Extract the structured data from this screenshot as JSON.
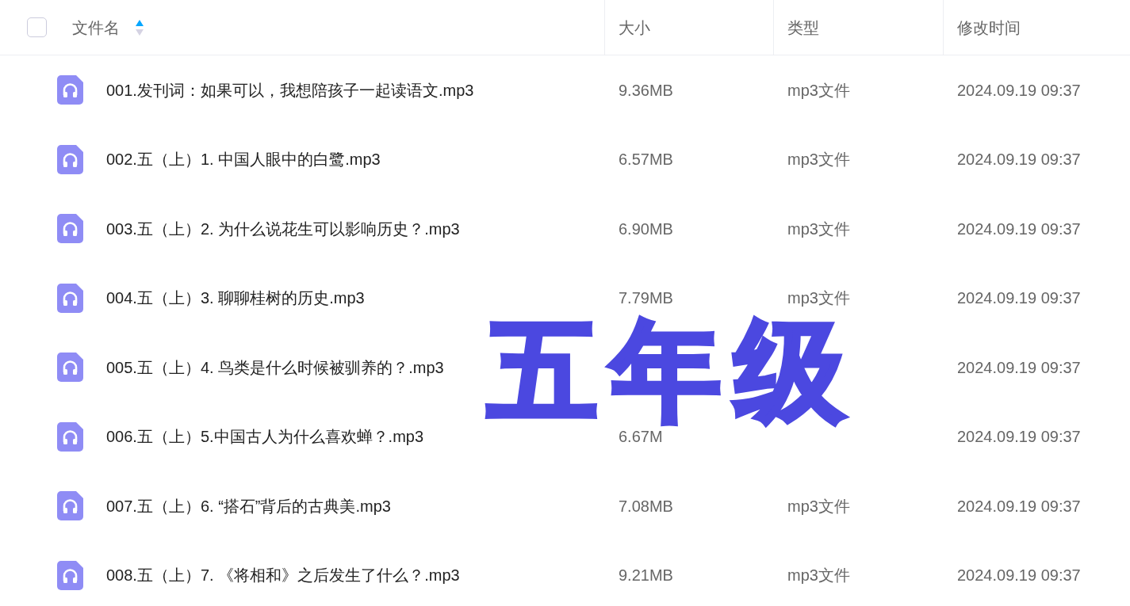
{
  "header": {
    "select_all": {
      "checked": false
    },
    "columns": [
      "文件名",
      "大小",
      "类型",
      "修改时间"
    ]
  },
  "rows": [
    {
      "name": "001.发刊词：如果可以，我想陪孩子一起读语文.mp3",
      "size": "9.36MB",
      "type": "mp3文件",
      "modified": "2024.09.19 09:37"
    },
    {
      "name": "002.五（上）1. 中国人眼中的白鹭.mp3",
      "size": "6.57MB",
      "type": "mp3文件",
      "modified": "2024.09.19 09:37"
    },
    {
      "name": "003.五（上）2. 为什么说花生可以影响历史？.mp3",
      "size": "6.90MB",
      "type": "mp3文件",
      "modified": "2024.09.19 09:37"
    },
    {
      "name": "004.五（上）3. 聊聊桂树的历史.mp3",
      "size": "7.79MB",
      "type": "mp3文件",
      "modified": "2024.09.19 09:37"
    },
    {
      "name": "005.五（上）4. 鸟类是什么时候被驯养的？.mp3",
      "modified": "2024.09.19 09:37"
    },
    {
      "name": "006.五（上）5.中国古人为什么喜欢蝉？.mp3",
      "size": "6.67M",
      "modified": "2024.09.19 09:37"
    },
    {
      "name": "007.五（上）6. “搭石”背后的古典美.mp3",
      "size": "7.08MB",
      "type": "mp3文件",
      "modified": "2024.09.19 09:37"
    },
    {
      "name": "008.五（上）7. 《将相和》之后发生了什么？.mp3",
      "size": "9.21MB",
      "type": "mp3文件",
      "modified": "2024.09.19 09:37"
    }
  ],
  "overlay_title": "五年级"
}
